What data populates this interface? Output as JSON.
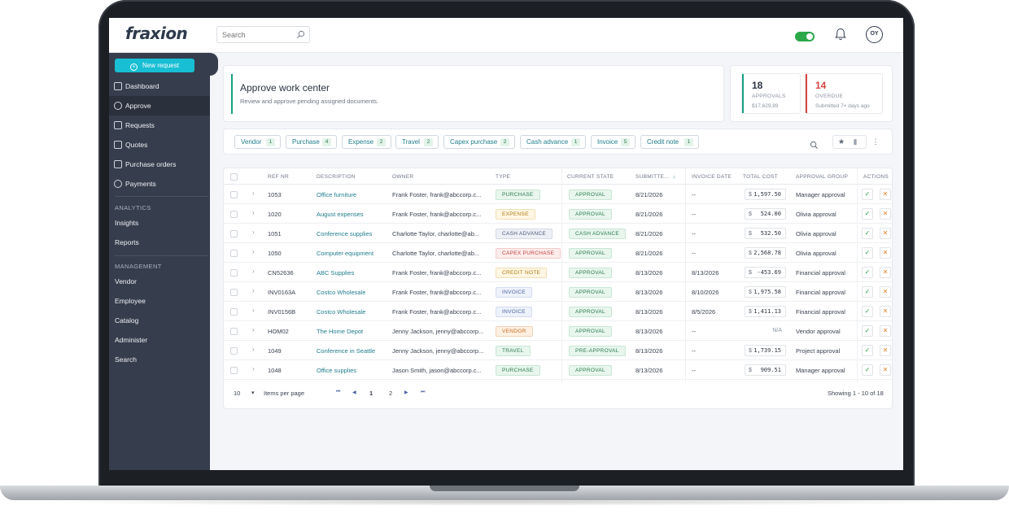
{
  "app": {
    "logo": "fraxion"
  },
  "topbar": {
    "search_placeholder": "Search",
    "avatar_initials": "OY"
  },
  "sidebar": {
    "new_request": "New request",
    "items": [
      {
        "label": "Dashboard",
        "icon": "dashboard-icon"
      },
      {
        "label": "Approve",
        "icon": "check-circle-icon"
      },
      {
        "label": "Requests",
        "icon": "requests-icon"
      },
      {
        "label": "Quotes",
        "icon": "quotes-icon"
      },
      {
        "label": "Purchase orders",
        "icon": "purchase-orders-icon"
      },
      {
        "label": "Payments",
        "icon": "dollar-icon"
      }
    ],
    "analytics_title": "ANALYTICS",
    "analytics": [
      "Insights",
      "Reports"
    ],
    "management_title": "MANAGEMENT",
    "management": [
      "Vendor",
      "Employee",
      "Catalog",
      "Administer",
      "Search"
    ]
  },
  "header": {
    "title": "Approve work center",
    "subtitle": "Review and approve pending assigned documents.",
    "approvals": {
      "count": "18",
      "label": "APPROVALS",
      "sub": "$17,629.89",
      "color": "#16a085"
    },
    "overdue": {
      "count": "14",
      "label": "OVERDUE",
      "sub": "Submitted 7+ days ago",
      "color": "#d64545"
    }
  },
  "filters": [
    {
      "label": "Vendor",
      "count": "1"
    },
    {
      "label": "Purchase",
      "count": "4"
    },
    {
      "label": "Expense",
      "count": "2"
    },
    {
      "label": "Travel",
      "count": "2"
    },
    {
      "label": "Capex purchase",
      "count": "2"
    },
    {
      "label": "Cash advance",
      "count": "1"
    },
    {
      "label": "Invoice",
      "count": "5"
    },
    {
      "label": "Credit note",
      "count": "1"
    }
  ],
  "table": {
    "columns": [
      "REF NR",
      "DESCRIPTION",
      "OWNER",
      "TYPE",
      "CURRENT STATE",
      "SUBMITTE...",
      "INVOICE DATE",
      "TOTAL COST",
      "APPROVAL GROUP",
      "ACTIONS"
    ],
    "rows": [
      {
        "ref": "1053",
        "desc": "Office furniture",
        "owner": "Frank Foster, frank@abccorp.c...",
        "type": "PURCHASE",
        "state": "APPROVAL",
        "submitted": "8/21/2026",
        "invoice": "--",
        "cost": "1,597.50",
        "group": "Manager approval"
      },
      {
        "ref": "1020",
        "desc": "August expenses",
        "owner": "Frank Foster, frank@abccorp.c...",
        "type": "EXPENSE",
        "state": "APPROVAL",
        "submitted": "8/21/2026",
        "invoice": "--",
        "cost": "524.00",
        "group": "Olivia approval"
      },
      {
        "ref": "1051",
        "desc": "Conference supplies",
        "owner": "Charlotte Taylor, charlotte@ab...",
        "type": "CASH ADVANCE",
        "state": "CASH ADVANCE",
        "submitted": "8/21/2026",
        "invoice": "--",
        "cost": "532.50",
        "group": "Olivia approval"
      },
      {
        "ref": "1050",
        "desc": "Computer equipment",
        "owner": "Charlotte Taylor, charlotte@ab...",
        "type": "CAPEX PURCHASE",
        "state": "APPROVAL",
        "submitted": "8/21/2026",
        "invoice": "--",
        "cost": "2,568.78",
        "group": "Olivia approval"
      },
      {
        "ref": "CN52636",
        "desc": "ABC Supplies",
        "owner": "Frank Foster, frank@abccorp.c...",
        "type": "CREDIT NOTE",
        "state": "APPROVAL",
        "submitted": "8/13/2026",
        "invoice": "8/13/2026",
        "cost": "-453.69",
        "group": "Financial approval"
      },
      {
        "ref": "INV0163A",
        "desc": "Costco Wholesale",
        "owner": "Frank Foster, frank@abccorp.c...",
        "type": "INVOICE",
        "state": "APPROVAL",
        "submitted": "8/13/2026",
        "invoice": "8/10/2026",
        "cost": "1,975.58",
        "group": "Financial approval"
      },
      {
        "ref": "INV0156B",
        "desc": "Costco Wholesale",
        "owner": "Frank Foster, frank@abccorp.c...",
        "type": "INVOICE",
        "state": "APPROVAL",
        "submitted": "8/13/2026",
        "invoice": "8/5/2026",
        "cost": "1,411.13",
        "group": "Financial approval"
      },
      {
        "ref": "HOM02",
        "desc": "The Home Depot",
        "owner": "Jenny Jackson, jenny@abccorp...",
        "type": "VENDOR",
        "state": "APPROVAL",
        "submitted": "8/13/2026",
        "invoice": "--",
        "cost": "N/A",
        "group": "Vendor approval"
      },
      {
        "ref": "1049",
        "desc": "Conference in Seattle",
        "owner": "Jenny Jackson, jenny@abccorp...",
        "type": "TRAVEL",
        "state": "PRE-APPROVAL",
        "submitted": "8/13/2026",
        "invoice": "--",
        "cost": "1,739.15",
        "group": "Project approval"
      },
      {
        "ref": "1048",
        "desc": "Office supplies",
        "owner": "Jason Smith, jason@abccorp.c...",
        "type": "PURCHASE",
        "state": "APPROVAL",
        "submitted": "8/13/2026",
        "invoice": "--",
        "cost": "909.51",
        "group": "Manager approval"
      }
    ]
  },
  "pager": {
    "per_page": "10",
    "per_page_label": "Items per page",
    "page1": "1",
    "page2": "2",
    "showing": "Showing 1 - 10 of 18"
  },
  "colors": {
    "accent": "#18bed3",
    "sidebar": "#363d4c",
    "link": "#1f7d8c"
  }
}
